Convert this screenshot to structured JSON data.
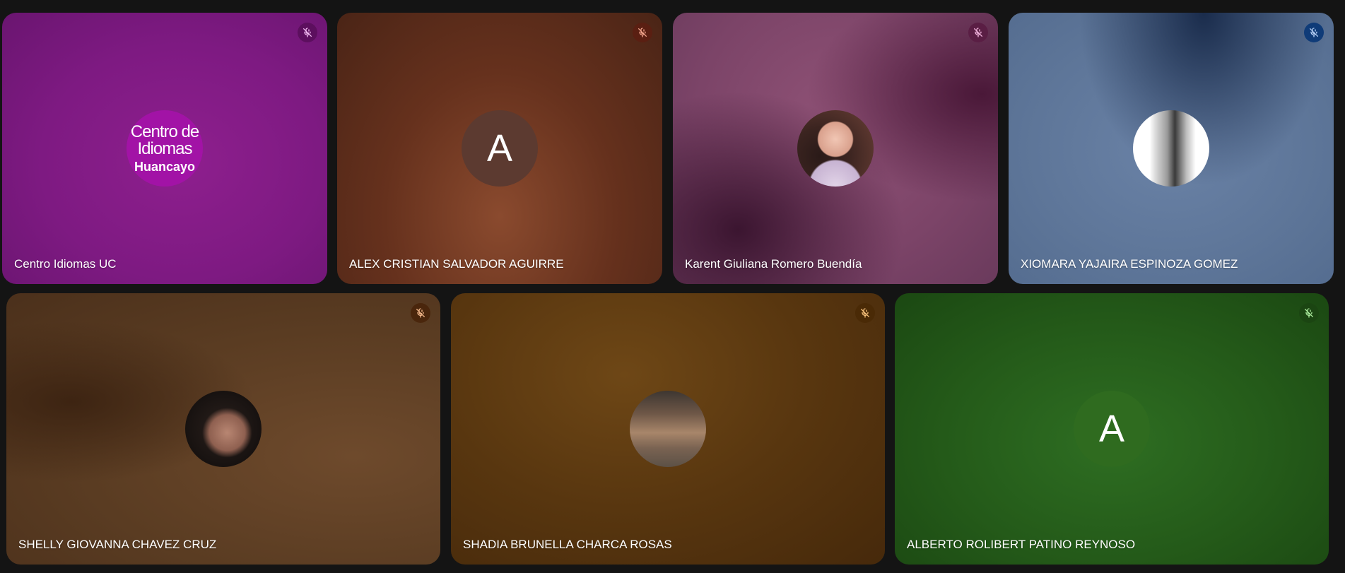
{
  "participants": [
    {
      "name": "Centro Idiomas UC",
      "avatar": {
        "type": "logo",
        "logo_lines": [
          "Centro de",
          "Idiomas",
          "Huancayo"
        ]
      },
      "mic_icon": "mic-off-icon",
      "mic_badge_color": "#5c0f5e",
      "mic_icon_color": "#f0b8f0"
    },
    {
      "name": "ALEX CRISTIAN SALVADOR AGUIRRE",
      "avatar": {
        "type": "letter",
        "letter": "A"
      },
      "mic_icon": "mic-off-icon",
      "mic_badge_color": "#5a1f12",
      "mic_icon_color": "#f2a48c"
    },
    {
      "name": "Karent Giuliana Romero Buendía",
      "avatar": {
        "type": "photo"
      },
      "mic_icon": "mic-off-icon",
      "mic_badge_color": "#5a1e44",
      "mic_icon_color": "#f2b3dd"
    },
    {
      "name": "XIOMARA YAJAIRA ESPINOZA GOMEZ",
      "avatar": {
        "type": "photo"
      },
      "mic_icon": "mic-off-icon",
      "mic_badge_color": "#0f3b78",
      "mic_icon_color": "#b6cff5"
    },
    {
      "name": "SHELLY GIOVANNA CHAVEZ CRUZ",
      "avatar": {
        "type": "photo"
      },
      "mic_icon": "mic-off-icon",
      "mic_badge_color": "#4a260c",
      "mic_icon_color": "#f5b98c"
    },
    {
      "name": "SHADIA BRUNELLA CHARCA ROSAS",
      "avatar": {
        "type": "photo"
      },
      "mic_icon": "mic-off-icon",
      "mic_badge_color": "#4a2a06",
      "mic_icon_color": "#f5bf7a"
    },
    {
      "name": "ALBERTO ROLIBERT PATINO REYNOSO",
      "avatar": {
        "type": "letter",
        "letter": "A"
      },
      "mic_icon": "mic-off-icon",
      "mic_badge_color": "#1b4512",
      "mic_icon_color": "#a8e89a"
    }
  ]
}
